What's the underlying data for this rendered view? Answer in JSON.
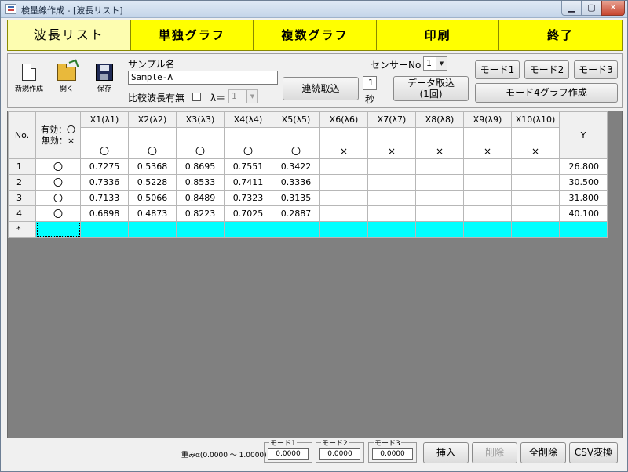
{
  "window": {
    "title": "検量線作成 - [波長リスト]"
  },
  "tabs": [
    "波長リスト",
    "単独グラフ",
    "複数グラフ",
    "印刷",
    "終了"
  ],
  "toolbar": {
    "new_label": "新規作成",
    "open_label": "開く",
    "save_label": "保存",
    "sample_label": "サンプル名",
    "sample_value": "Sample-A",
    "compare_label": "比較波長有無",
    "lambda_label": "λ＝",
    "lambda_value": "1",
    "continuous_label": "連続取込",
    "interval_value": "1",
    "interval_unit": "秒",
    "sensor_label": "センサーNo",
    "sensor_value": "1",
    "data_capture_line1": "データ取込",
    "data_capture_line2": "(1回)",
    "mode1_label": "モード1",
    "mode2_label": "モード2",
    "mode3_label": "モード3",
    "mode4_label": "モード4グラフ作成"
  },
  "grid": {
    "no_header": "No.",
    "valid_header1": "有効：〇",
    "valid_header2": "無効：×",
    "y_header": "Y",
    "x_headers": [
      "X1(λ1)",
      "X2(λ2)",
      "X3(λ3)",
      "X4(λ4)",
      "X5(λ5)",
      "X6(λ6)",
      "X7(λ7)",
      "X8(λ8)",
      "X9(λ9)",
      "X10(λ10)"
    ],
    "x_flags": [
      "〇",
      "〇",
      "〇",
      "〇",
      "〇",
      "×",
      "×",
      "×",
      "×",
      "×"
    ],
    "rows": [
      {
        "no": "1",
        "valid": "〇",
        "x": [
          "0.7275",
          "0.5368",
          "0.8695",
          "0.7551",
          "0.3422"
        ],
        "y": "26.800"
      },
      {
        "no": "2",
        "valid": "〇",
        "x": [
          "0.7336",
          "0.5228",
          "0.8533",
          "0.7411",
          "0.3336"
        ],
        "y": "30.500"
      },
      {
        "no": "3",
        "valid": "〇",
        "x": [
          "0.7133",
          "0.5066",
          "0.8489",
          "0.7323",
          "0.3135"
        ],
        "y": "31.800"
      },
      {
        "no": "4",
        "valid": "〇",
        "x": [
          "0.6898",
          "0.4873",
          "0.8223",
          "0.7025",
          "0.2887"
        ],
        "y": "40.100"
      }
    ],
    "new_row_marker": "*"
  },
  "bottom": {
    "weight_label": "重みα(0.0000 ～ 1.0000)",
    "mode1_caption": "モード1",
    "mode1_value": "0.0000",
    "mode2_caption": "モード2",
    "mode2_value": "0.0000",
    "mode3_caption": "モード3",
    "mode3_value": "0.0000",
    "insert_label": "挿入",
    "delete_label": "削除",
    "delete_all_label": "全削除",
    "csv_label": "CSV変換"
  }
}
